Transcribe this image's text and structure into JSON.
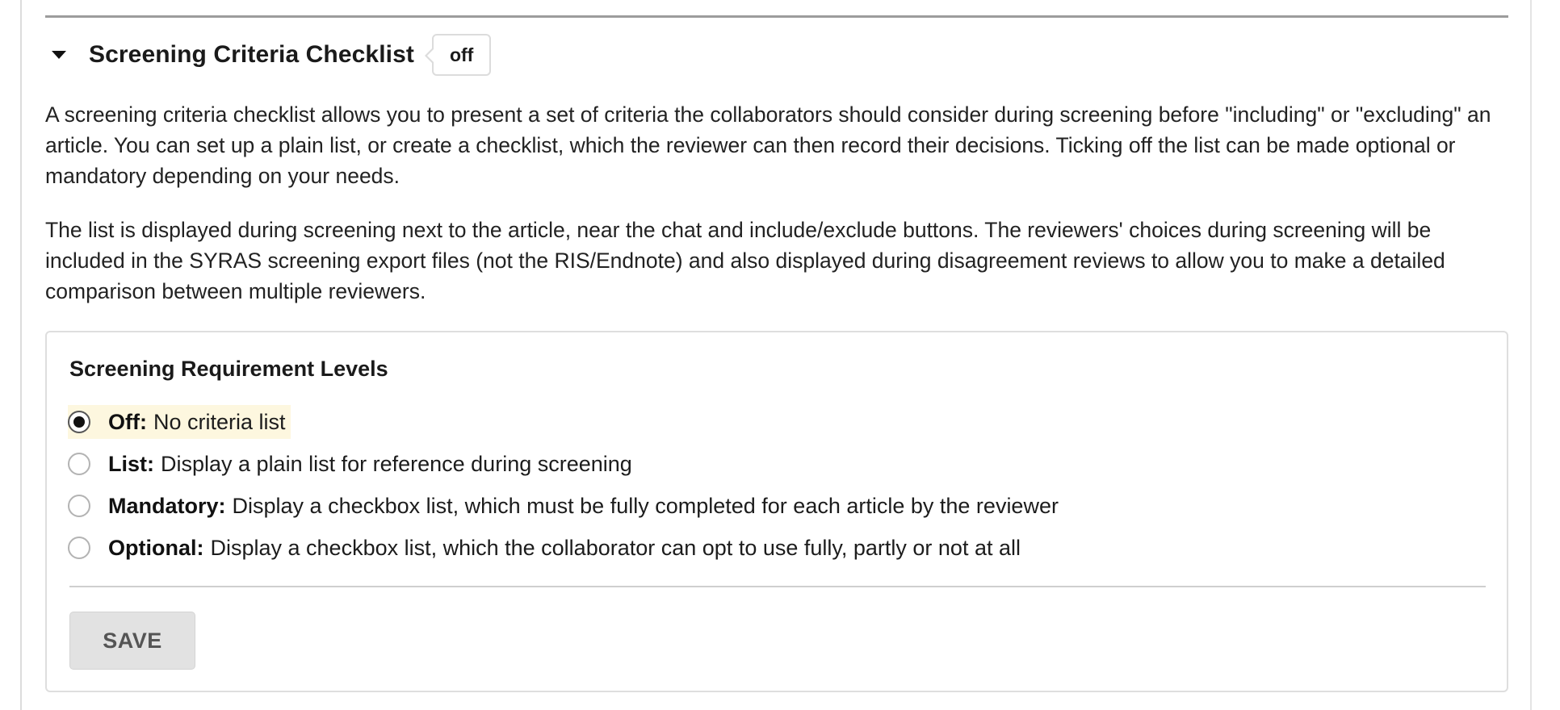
{
  "section": {
    "title": "Screening Criteria Checklist",
    "status_badge": "off"
  },
  "description": {
    "paragraph_1": "A screening criteria checklist allows you to present a set of criteria the collaborators should consider during screening before \"including\" or \"excluding\" an article. You can set up a plain list, or create a checklist, which the reviewer can then record their decisions. Ticking off the list can be made optional or mandatory depending on your needs.",
    "paragraph_2": "The list is displayed during screening next to the article, near the chat and include/exclude buttons. The reviewers' choices during screening will be included in the SYRAS screening export files (not the RIS/Endnote) and also displayed during disagreement reviews to allow you to make a detailed comparison between multiple reviewers."
  },
  "requirement_levels": {
    "title": "Screening Requirement Levels",
    "selected": "off",
    "options": [
      {
        "key": "Off:",
        "text": "No criteria list",
        "checked": true
      },
      {
        "key": "List:",
        "text": "Display a plain list for reference during screening",
        "checked": false
      },
      {
        "key": "Mandatory:",
        "text": "Display a checkbox list, which must be fully completed for each article by the reviewer",
        "checked": false
      },
      {
        "key": "Optional:",
        "text": "Display a checkbox list, which the collaborator can opt to use fully, partly or not at all",
        "checked": false
      }
    ],
    "save_label": "SAVE"
  },
  "colors": {
    "selected_highlight": "#fdf7df",
    "save_button_bg": "#e2e2e2",
    "border": "#dedede"
  }
}
